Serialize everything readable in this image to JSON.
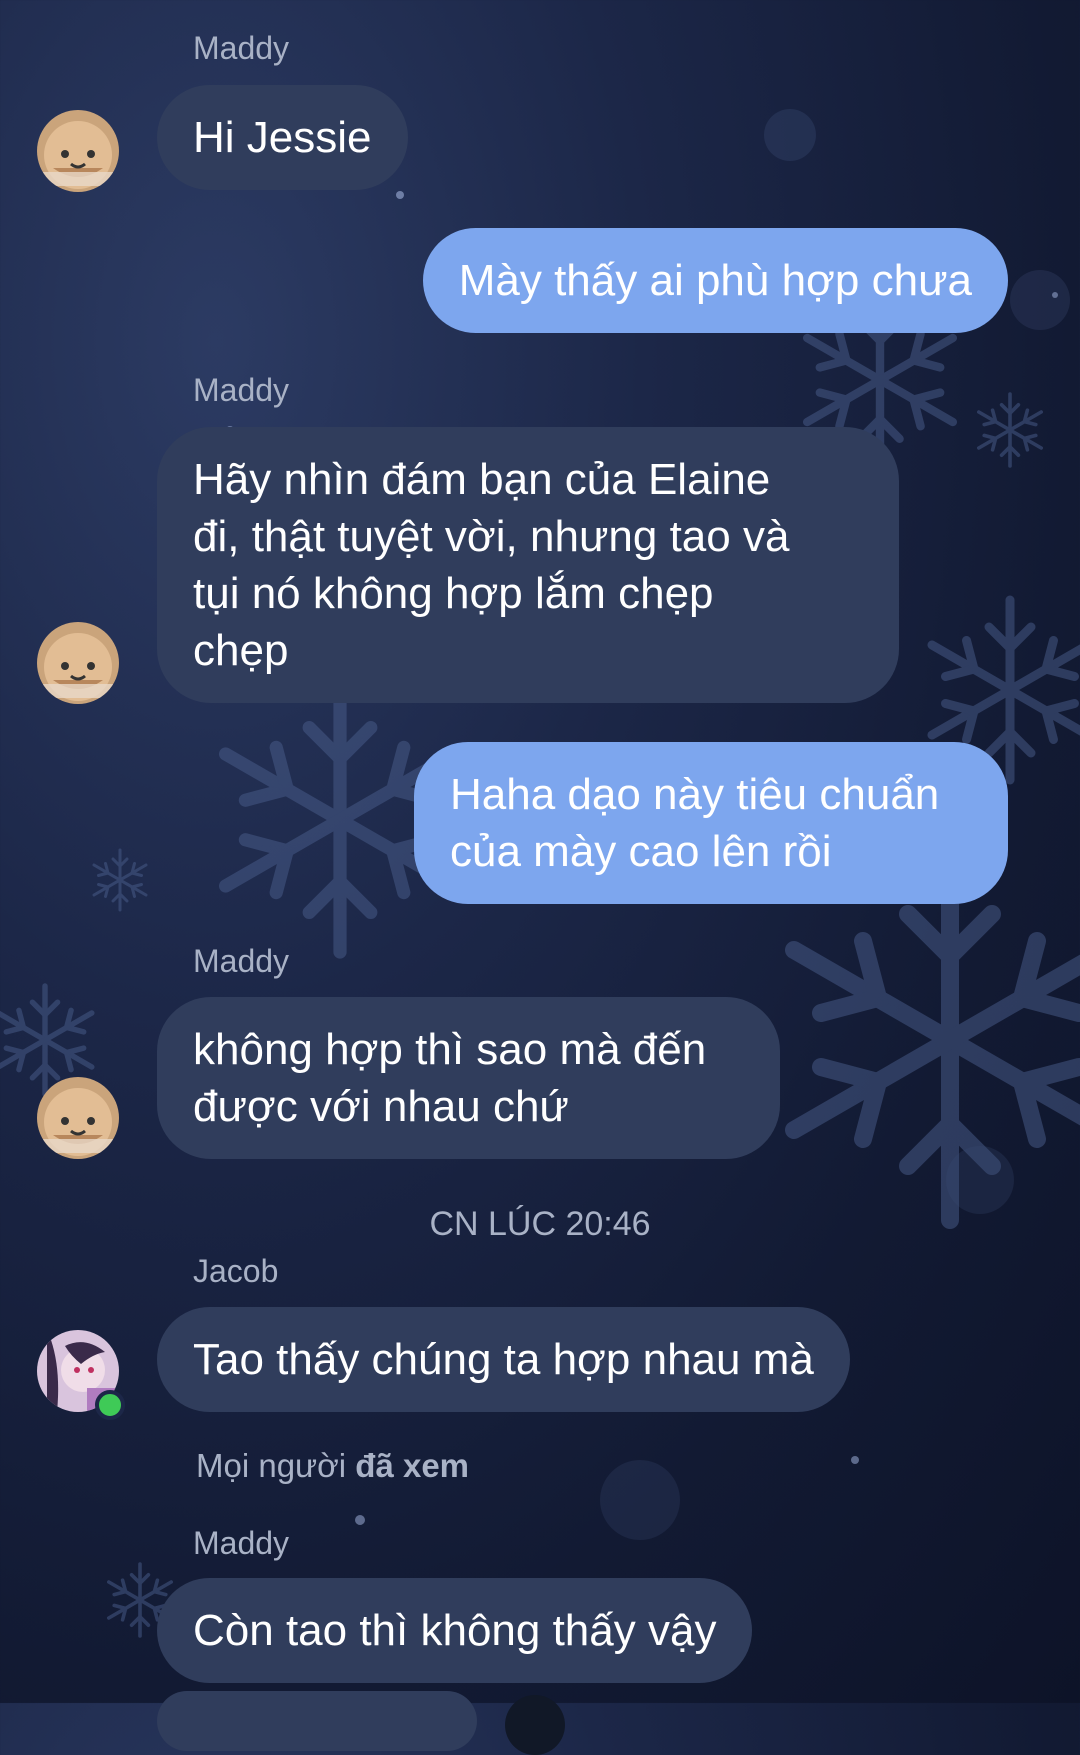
{
  "colors": {
    "background": "#1c2748",
    "incoming_bubble": "#303d5c",
    "outgoing_bubble": "#7da6ee",
    "secondary_text": "#a9b2c6",
    "online_status": "#3fca57"
  },
  "messages": [
    {
      "sender": "Maddy",
      "text": "Hi Jessie",
      "direction": "incoming",
      "avatar": "maddy-avatar"
    },
    {
      "text": "Mày thấy ai phù hợp chưa",
      "direction": "outgoing"
    },
    {
      "sender": "Maddy",
      "lines": [
        "Hãy nhìn đám bạn của Elaine",
        "đi, thật tuyệt vời, nhưng tao và",
        "tụi nó không hợp lắm chẹp",
        "chẹp"
      ],
      "direction": "incoming",
      "avatar": "maddy-avatar"
    },
    {
      "lines": [
        "Haha dạo này tiêu chuẩn",
        "của mày cao lên rồi"
      ],
      "direction": "outgoing"
    },
    {
      "sender": "Maddy",
      "lines": [
        "không hợp thì sao mà đến",
        "được với nhau chứ"
      ],
      "direction": "incoming",
      "avatar": "maddy-avatar"
    },
    {
      "sender": "Jacob",
      "text": "Tao thấy chúng ta hợp nhau mà",
      "direction": "incoming",
      "avatar": "jacob-avatar"
    },
    {
      "sender": "Maddy",
      "text": "Còn tao thì không thấy vậy",
      "direction": "incoming"
    }
  ],
  "timestamp": "CN LÚC 20:46",
  "seen_status": {
    "prefix": "Mọi người",
    "emphasis": "đã xem"
  }
}
